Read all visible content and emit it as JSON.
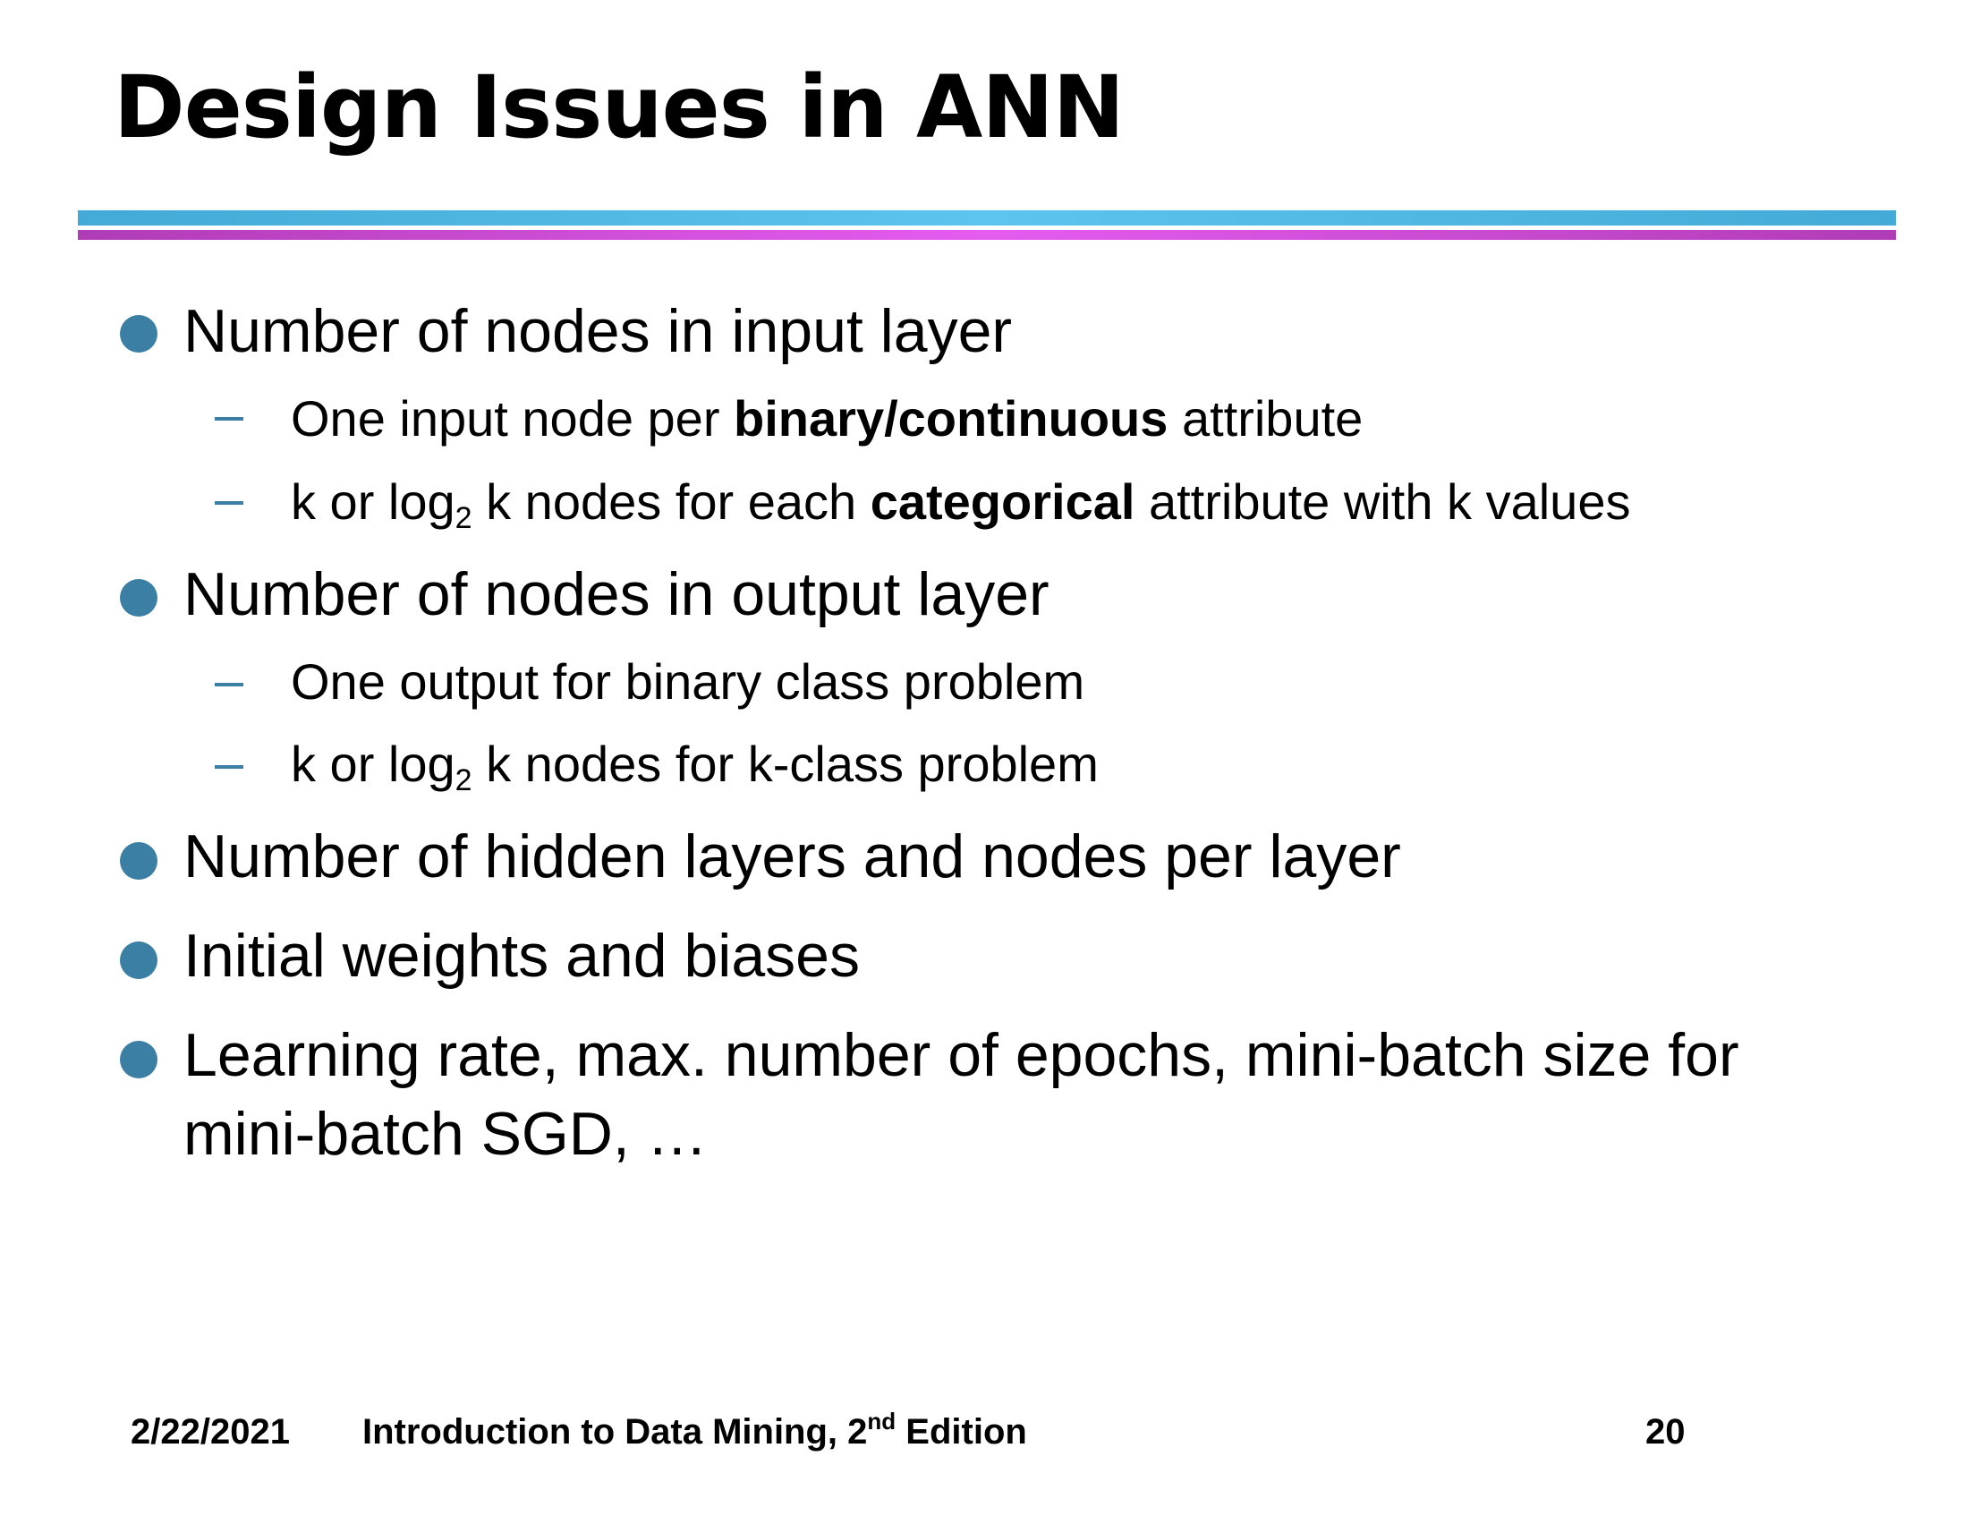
{
  "slide": {
    "title": "Design Issues in ANN"
  },
  "bullets": [
    {
      "text": "Number of nodes in input layer"
    },
    {
      "text": "Number of nodes in output layer"
    },
    {
      "text": "Number of hidden layers and nodes per layer"
    },
    {
      "text": "Initial weights and biases"
    },
    {
      "text": "Learning rate, max. number of epochs, mini-batch size for mini-batch SGD, …"
    }
  ],
  "sub_items": {
    "input_1": {
      "pre": "One input node per ",
      "bold": "binary/continuous",
      "post": " attribute"
    },
    "input_2": {
      "pre": "k or log",
      "sub": "2",
      "mid": " k nodes for each ",
      "bold": "categorical",
      "post": " attribute with k values"
    },
    "output_1": {
      "text": "One output for binary class problem"
    },
    "output_2": {
      "pre": "k or log",
      "sub": "2",
      "post": " k nodes for k-class problem"
    }
  },
  "footer": {
    "date": "2/22/2021",
    "book_pre": "Introduction to Data Mining, 2",
    "book_sup": "nd",
    "book_post": " Edition",
    "page_number": "20"
  },
  "colors": {
    "bullet": "#3c7fa4",
    "rule_top": "#5cc4ee",
    "rule_bottom": "#e55cf0"
  }
}
